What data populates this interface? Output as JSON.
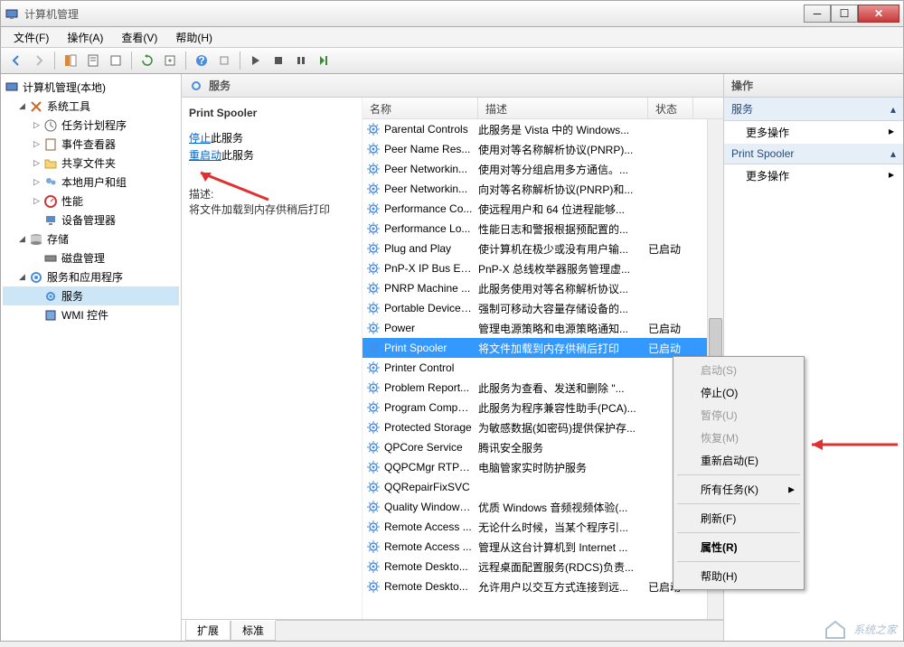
{
  "window": {
    "title": "计算机管理"
  },
  "menu": {
    "file": "文件(F)",
    "action": "操作(A)",
    "view": "查看(V)",
    "help": "帮助(H)"
  },
  "tree": {
    "root": "计算机管理(本地)",
    "system_tools": "系统工具",
    "task_scheduler": "任务计划程序",
    "event_viewer": "事件查看器",
    "shared_folders": "共享文件夹",
    "local_users": "本地用户和组",
    "performance": "性能",
    "device_manager": "设备管理器",
    "storage": "存储",
    "disk_mgmt": "磁盘管理",
    "services_apps": "服务和应用程序",
    "services": "服务",
    "wmi": "WMI 控件"
  },
  "center": {
    "header": "服务"
  },
  "detail": {
    "title": "Print Spooler",
    "stop_prefix": "停止",
    "stop_suffix": "此服务",
    "restart_prefix": "重启动",
    "restart_suffix": "此服务",
    "desc_label": "描述:",
    "desc": "将文件加载到内存供稍后打印"
  },
  "columns": {
    "name": "名称",
    "desc": "描述",
    "status": "状态"
  },
  "services": [
    {
      "name": "Parental Controls",
      "desc": "此服务是 Vista 中的 Windows...",
      "status": ""
    },
    {
      "name": "Peer Name Res...",
      "desc": "使用对等名称解析协议(PNRP)...",
      "status": ""
    },
    {
      "name": "Peer Networkin...",
      "desc": "使用对等分组启用多方通信。...",
      "status": ""
    },
    {
      "name": "Peer Networkin...",
      "desc": "向对等名称解析协议(PNRP)和...",
      "status": ""
    },
    {
      "name": "Performance Co...",
      "desc": "使远程用户和 64 位进程能够...",
      "status": ""
    },
    {
      "name": "Performance Lo...",
      "desc": "性能日志和警报根据预配置的...",
      "status": ""
    },
    {
      "name": "Plug and Play",
      "desc": "使计算机在极少或没有用户输...",
      "status": "已启动"
    },
    {
      "name": "PnP-X IP Bus En...",
      "desc": "PnP-X 总线枚举器服务管理虚...",
      "status": ""
    },
    {
      "name": "PNRP Machine ...",
      "desc": "此服务使用对等名称解析协议...",
      "status": ""
    },
    {
      "name": "Portable Device ...",
      "desc": "强制可移动大容量存储设备的...",
      "status": ""
    },
    {
      "name": "Power",
      "desc": "管理电源策略和电源策略通知...",
      "status": "已启动"
    },
    {
      "name": "Print Spooler",
      "desc": "将文件加载到内存供稍后打印",
      "status": "已启动",
      "selected": true
    },
    {
      "name": "Printer Control",
      "desc": "",
      "status": ""
    },
    {
      "name": "Problem Report...",
      "desc": "此服务为查看、发送和删除 \"...",
      "status": ""
    },
    {
      "name": "Program Compa...",
      "desc": "此服务为程序兼容性助手(PCA)...",
      "status": ""
    },
    {
      "name": "Protected Storage",
      "desc": "为敏感数据(如密码)提供保护存...",
      "status": ""
    },
    {
      "name": "QPCore Service",
      "desc": "腾讯安全服务",
      "status": ""
    },
    {
      "name": "QQPCMgr RTP S...",
      "desc": "电脑管家实时防护服务",
      "status": ""
    },
    {
      "name": "QQRepairFixSVC",
      "desc": "",
      "status": ""
    },
    {
      "name": "Quality Windows...",
      "desc": "优质 Windows 音频视频体验(...",
      "status": ""
    },
    {
      "name": "Remote Access ...",
      "desc": "无论什么时候，当某个程序引...",
      "status": ""
    },
    {
      "name": "Remote Access ...",
      "desc": "管理从这台计算机到 Internet ...",
      "status": ""
    },
    {
      "name": "Remote Deskto...",
      "desc": "远程桌面配置服务(RDCS)负责...",
      "status": ""
    },
    {
      "name": "Remote Deskto...",
      "desc": "允许用户以交互方式连接到远...",
      "status": "已启动"
    }
  ],
  "tabs": {
    "extended": "扩展",
    "standard": "标准"
  },
  "actions": {
    "header": "操作",
    "section1": "服务",
    "more1": "更多操作",
    "section2": "Print Spooler",
    "more2": "更多操作"
  },
  "context_menu": {
    "start": "启动(S)",
    "stop": "停止(O)",
    "pause": "暂停(U)",
    "resume": "恢复(M)",
    "restart": "重新启动(E)",
    "all_tasks": "所有任务(K)",
    "refresh": "刷新(F)",
    "properties": "属性(R)",
    "help": "帮助(H)"
  },
  "watermark": "系统之家"
}
